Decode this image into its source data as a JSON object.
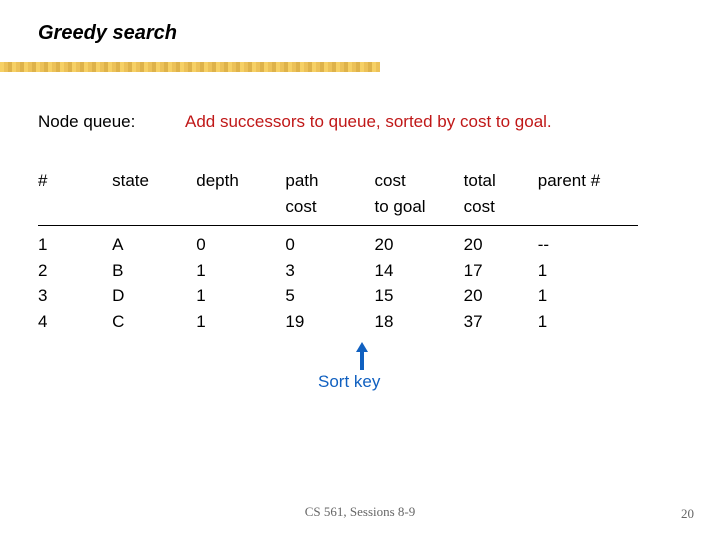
{
  "title": "Greedy search",
  "queue": {
    "label": "Node queue:",
    "desc": "Add successors to queue, sorted by cost to goal."
  },
  "table": {
    "headers": {
      "num": "#",
      "state": "state",
      "depth": "depth",
      "path_cost_l1": "path",
      "path_cost_l2": "cost",
      "cost_goal_l1": "cost",
      "cost_goal_l2": "to goal",
      "total_l1": "total",
      "total_l2": "cost",
      "parent": "parent #"
    },
    "rows": [
      {
        "num": "1",
        "state": "A",
        "depth": "0",
        "path_cost": "0",
        "cost_goal": "20",
        "total": "20",
        "parent": "--"
      },
      {
        "num": "2",
        "state": "B",
        "depth": "1",
        "path_cost": "3",
        "cost_goal": "14",
        "total": "17",
        "parent": "1"
      },
      {
        "num": "3",
        "state": "D",
        "depth": "1",
        "path_cost": "5",
        "cost_goal": "15",
        "total": "20",
        "parent": "1"
      },
      {
        "num": "4",
        "state": "C",
        "depth": "1",
        "path_cost": "19",
        "cost_goal": "18",
        "total": "37",
        "parent": "1"
      }
    ]
  },
  "sort_key": "Sort key",
  "footer": "CS 561, Sessions 8-9",
  "page_number": "20",
  "chart_data": {
    "type": "table",
    "title": "Greedy search node queue",
    "columns": [
      "#",
      "state",
      "depth",
      "path cost",
      "cost to goal",
      "total cost",
      "parent #"
    ],
    "rows": [
      [
        1,
        "A",
        0,
        0,
        20,
        20,
        null
      ],
      [
        2,
        "B",
        1,
        3,
        14,
        17,
        1
      ],
      [
        3,
        "D",
        1,
        5,
        15,
        20,
        1
      ],
      [
        4,
        "C",
        1,
        19,
        18,
        37,
        1
      ]
    ],
    "sort_key_column": "cost to goal"
  }
}
